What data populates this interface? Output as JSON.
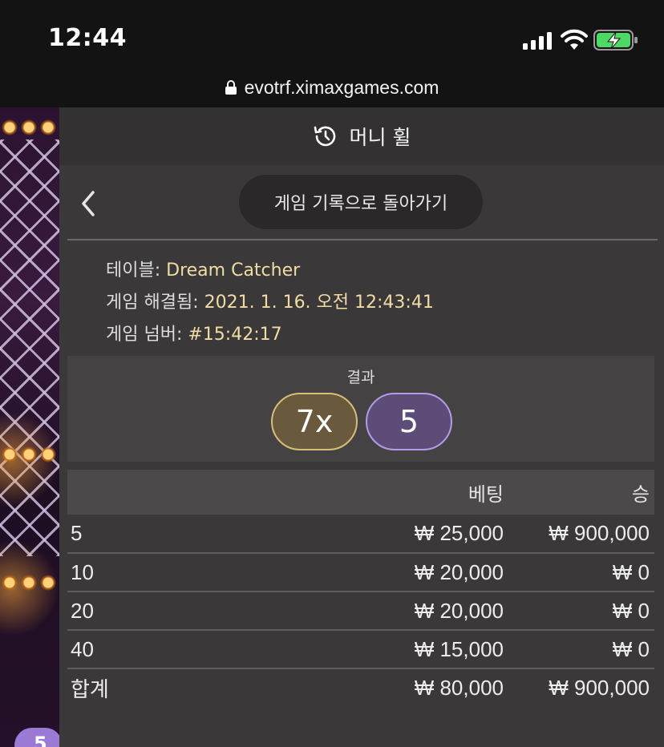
{
  "status_bar": {
    "time": "12:44"
  },
  "browser": {
    "url": "evotrf.ximaxgames.com"
  },
  "panel": {
    "title": "머니 휠",
    "back_button_label": "게임 기록으로 돌아가기"
  },
  "info": {
    "table_label": "테이블:",
    "table_value": "Dream Catcher",
    "resolved_label": "게임 해결됨:",
    "resolved_value": "2021. 1. 16. 오전 12:43:41",
    "number_label": "게임 넘버:",
    "number_value": "#15:42:17"
  },
  "result": {
    "label": "결과",
    "multiplier": "7x",
    "number": "5"
  },
  "bets_table": {
    "headers": {
      "name": "",
      "bet": "베팅",
      "win": "승"
    },
    "rows": [
      {
        "name": "5",
        "bet": "₩ 25,000",
        "win": "₩ 900,000"
      },
      {
        "name": "10",
        "bet": "₩ 20,000",
        "win": "₩ 0"
      },
      {
        "name": "20",
        "bet": "₩ 20,000",
        "win": "₩ 0"
      },
      {
        "name": "40",
        "bet": "₩ 15,000",
        "win": "₩ 0"
      }
    ],
    "total": {
      "name": "합계",
      "bet": "₩ 80,000",
      "win": "₩ 900,000"
    }
  },
  "background": {
    "corner_ball": "5"
  },
  "colors": {
    "panel": "#3a3839",
    "accent_gold": "#d8bf78",
    "accent_purple": "#b59be6",
    "info_value": "#f1dca6"
  }
}
